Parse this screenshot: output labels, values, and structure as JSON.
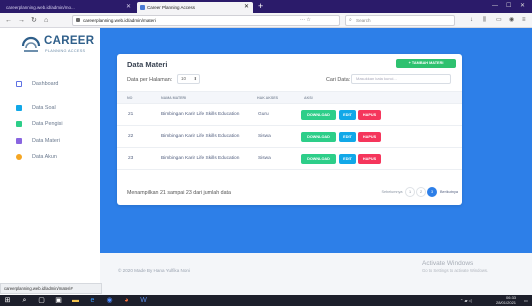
{
  "browser": {
    "tabs": [
      {
        "title": "careerplanning.web.id/admin/mo...",
        "active": false
      },
      {
        "title": "Career Planning Access",
        "active": true
      }
    ],
    "url": "careerplanning.web.id/admin/materi",
    "search_placeholder": "Search",
    "status_url": "careerplanning.web.id/admin/materi#"
  },
  "logo": {
    "title": "CAREER",
    "subtitle": "PLANNING ACCESS"
  },
  "sidebar": {
    "items": [
      {
        "label": "Dashboard",
        "icon": "monitor-icon",
        "color": "#5e72e4"
      },
      {
        "label": "Data Soal",
        "icon": "list-icon",
        "color": "#11a8e8"
      },
      {
        "label": "Data Pengisi",
        "icon": "users-icon",
        "color": "#2dce89"
      },
      {
        "label": "Data Materi",
        "icon": "book-icon",
        "color": "#8965e0"
      },
      {
        "label": "Data Akun",
        "icon": "user-icon",
        "color": "#f5a623"
      }
    ]
  },
  "card": {
    "title": "Data Materi",
    "add_button": "+ TAMBAH MATERI",
    "per_page_label": "Data per Halaman:",
    "per_page_value": "10",
    "search_label": "Cari Data:",
    "search_placeholder": "Masukkan kata kunci...",
    "columns": [
      "NO",
      "NAMA MATERI",
      "HAK AKSES",
      "AKSI"
    ],
    "rows": [
      {
        "no": "21",
        "name": "Bimbingan Karir Life Skills Education",
        "access": "Guru"
      },
      {
        "no": "22",
        "name": "Bimbingan Karir Life Skills Education",
        "access": "Siswa"
      },
      {
        "no": "23",
        "name": "Bimbingan Karir Life Skills Education",
        "access": "Siswa"
      }
    ],
    "actions": {
      "download": "DOWNLOAD",
      "edit": "EDIT",
      "delete": "HAPUS"
    },
    "info": "Menampilkan 21 sampai 23 dari jumlah data",
    "pagination": {
      "prev": "Sebelumnya",
      "pages": [
        "1",
        "2",
        "3"
      ],
      "active": "3",
      "next": "Berikutnya"
    }
  },
  "footer": {
    "copyright": "© 2020 Made By Hana Yulfika Noni"
  },
  "watermark": {
    "line1": "Activate Windows",
    "line2": "Go to Settings to activate Windows."
  },
  "taskbar": {
    "time": "06:33",
    "date": "28/01/2021"
  }
}
